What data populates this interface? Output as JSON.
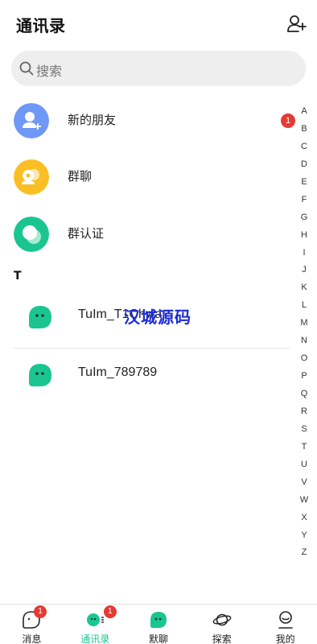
{
  "header": {
    "title": "通讯录",
    "add_icon": "add-friend-icon"
  },
  "search": {
    "placeholder": "搜索",
    "icon": "search-icon"
  },
  "menu": [
    {
      "label": "新的朋友",
      "icon": "new-friend-icon",
      "color": "#6f98f6",
      "badge": "1"
    },
    {
      "label": "群聊",
      "icon": "group-chat-icon",
      "color": "#fbbf24"
    },
    {
      "label": "群认证",
      "icon": "group-verify-icon",
      "color": "#1bc58f"
    }
  ],
  "section_letter": "T",
  "contacts": [
    {
      "name": "TuIm_T1Chwa"
    },
    {
      "name": "TuIm_789789"
    }
  ],
  "watermark": "汉城源码",
  "index_letters": [
    "A",
    "B",
    "C",
    "D",
    "E",
    "F",
    "G",
    "H",
    "I",
    "J",
    "K",
    "L",
    "M",
    "N",
    "O",
    "P",
    "Q",
    "R",
    "S",
    "T",
    "U",
    "V",
    "W",
    "X",
    "Y",
    "Z"
  ],
  "tabs": [
    {
      "label": "消息",
      "icon": "message-icon",
      "badge": "1"
    },
    {
      "label": "通讯录",
      "icon": "contacts-icon",
      "badge": "1",
      "active": true
    },
    {
      "label": "默聊",
      "icon": "chat-bot-icon"
    },
    {
      "label": "探索",
      "icon": "planet-icon"
    },
    {
      "label": "我的",
      "icon": "profile-icon"
    }
  ],
  "colors": {
    "accent": "#1bc58f",
    "badge": "#e53935",
    "watermark": "#1c2bd6"
  }
}
